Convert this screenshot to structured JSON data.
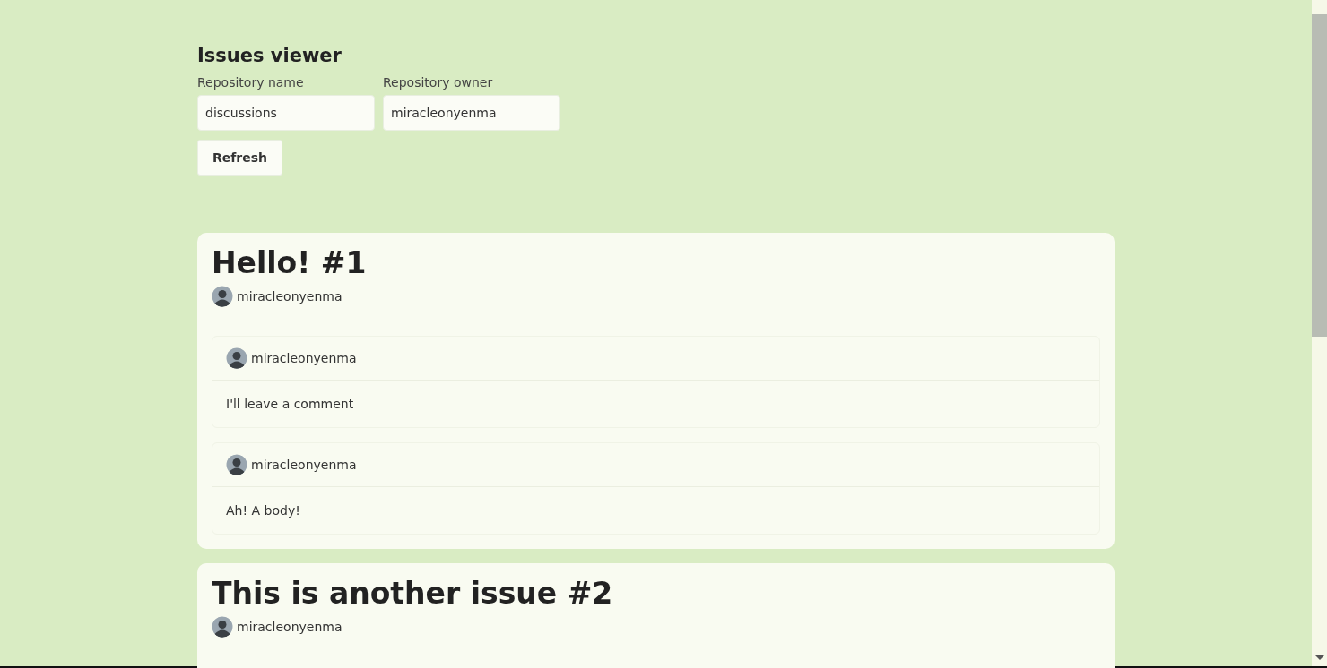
{
  "title": "Issues viewer",
  "form": {
    "fields": [
      {
        "label": "Repository name",
        "value": "discussions"
      },
      {
        "label": "Repository owner",
        "value": "miracleonyenma"
      }
    ],
    "button": "Refresh"
  },
  "issues": [
    {
      "title": "Hello! #1",
      "author": "miracleonyenma",
      "comments": [
        {
          "author": "miracleonyenma",
          "body": "I'll leave a comment"
        },
        {
          "author": "miracleonyenma",
          "body": "Ah! A body!"
        }
      ]
    },
    {
      "title": "This is another issue #2",
      "author": "miracleonyenma"
    }
  ]
}
